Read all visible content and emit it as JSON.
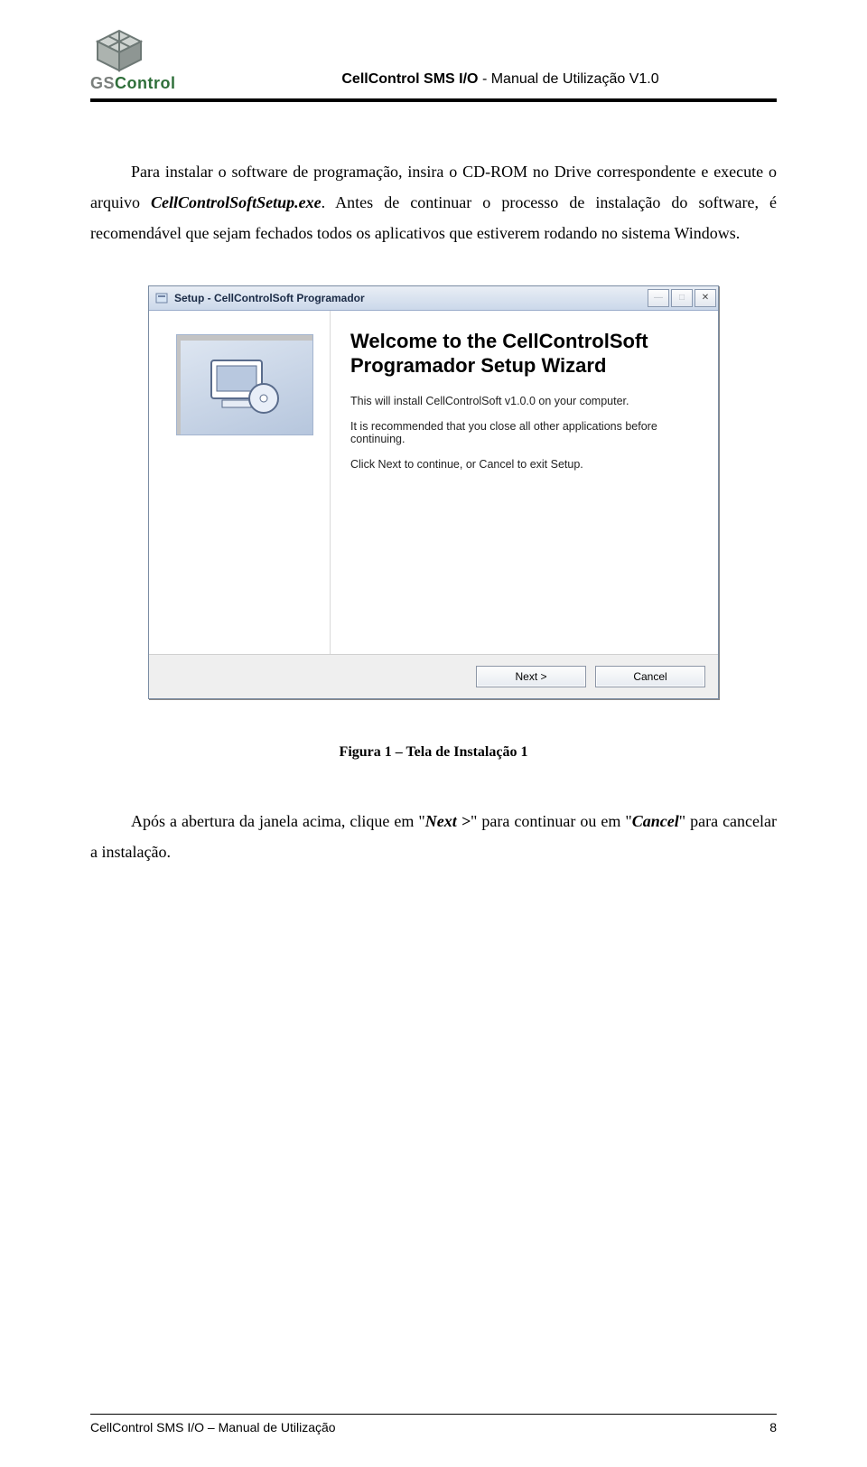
{
  "header": {
    "logo_top": "GS",
    "logo_bottom": "Control",
    "title_bold": "CellControl SMS I/O",
    "title_rest": " - Manual de Utilização V1.0"
  },
  "body": {
    "p1_before": "Para instalar o software de programação, insira o CD-ROM no Drive correspondente e execute o arquivo ",
    "p1_bi": "CellControlSoftSetup.exe",
    "p1_after": ". Antes de continuar o processo de instalação do software, é recomendável que sejam fechados todos os aplicativos que estiverem rodando no sistema Windows."
  },
  "installer": {
    "title": "Setup - CellControlSoft Programador",
    "welcome_l1": "Welcome to the CellControlSoft",
    "welcome_l2": "Programador Setup Wizard",
    "line1": "This will install CellControlSoft v1.0.0 on your computer.",
    "line2": "It is recommended that you close all other applications before continuing.",
    "line3": "Click Next to continue, or Cancel to exit Setup.",
    "next_label": "Next >",
    "cancel_label": "Cancel",
    "min_glyph": "—",
    "max_glyph": "□",
    "close_glyph": "✕"
  },
  "figure_caption": "Figura 1 – Tela de Instalação 1",
  "after": {
    "before": "Após a abertura da janela acima, clique em \"",
    "bi1": "Next >",
    "mid": "\" para continuar ou em \"",
    "bi2": "Cancel",
    "after": "\" para cancelar a instalação."
  },
  "footer": {
    "left": "CellControl SMS I/O – Manual de Utilização",
    "right": "8"
  }
}
